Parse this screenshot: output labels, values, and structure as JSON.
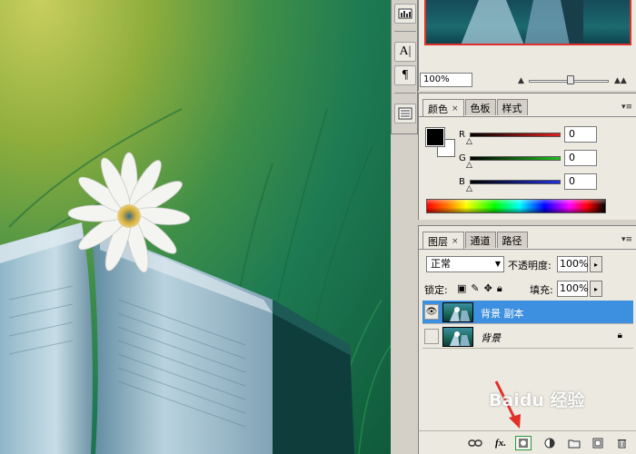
{
  "colors": {
    "accent": "#3d8fe0",
    "red_arrow": "#e0302a",
    "panel_bg": "#ece9e0"
  },
  "toolstrip": {
    "items": [
      {
        "icon": "histogram-icon"
      },
      {
        "icon": "character-icon",
        "glyph": "A|"
      },
      {
        "icon": "paragraph-icon",
        "glyph": "¶"
      },
      {
        "icon": "info-panel-icon"
      }
    ]
  },
  "navigator": {
    "zoom": "100%"
  },
  "color_panel": {
    "tabs": [
      {
        "label": "颜色",
        "close": "×"
      },
      {
        "label": "色板"
      },
      {
        "label": "样式"
      }
    ],
    "channels": [
      {
        "label": "R",
        "value": "0",
        "color": "#d02020"
      },
      {
        "label": "G",
        "value": "0",
        "color": "#20b020"
      },
      {
        "label": "B",
        "value": "0",
        "color": "#2030d0"
      }
    ]
  },
  "layers_panel": {
    "tabs": [
      {
        "label": "图层",
        "close": "×"
      },
      {
        "label": "通道"
      },
      {
        "label": "路径"
      }
    ],
    "blend_mode": "正常",
    "opacity_label": "不透明度:",
    "opacity_value": "100%",
    "lock_label": "锁定:",
    "fill_label": "填充:",
    "fill_value": "100%",
    "layers": [
      {
        "name": "背景 副本",
        "visible": true,
        "selected": true
      },
      {
        "name": "背景",
        "visible": false,
        "selected": false,
        "locked": true
      }
    ],
    "bottom_icons": [
      "link-layers-icon",
      "fx-icon",
      "add-mask-icon",
      "adjustment-layer-icon",
      "new-group-icon",
      "new-layer-icon",
      "delete-layer-icon"
    ],
    "fx_label": "fx."
  },
  "watermark": "Baidu 经验"
}
